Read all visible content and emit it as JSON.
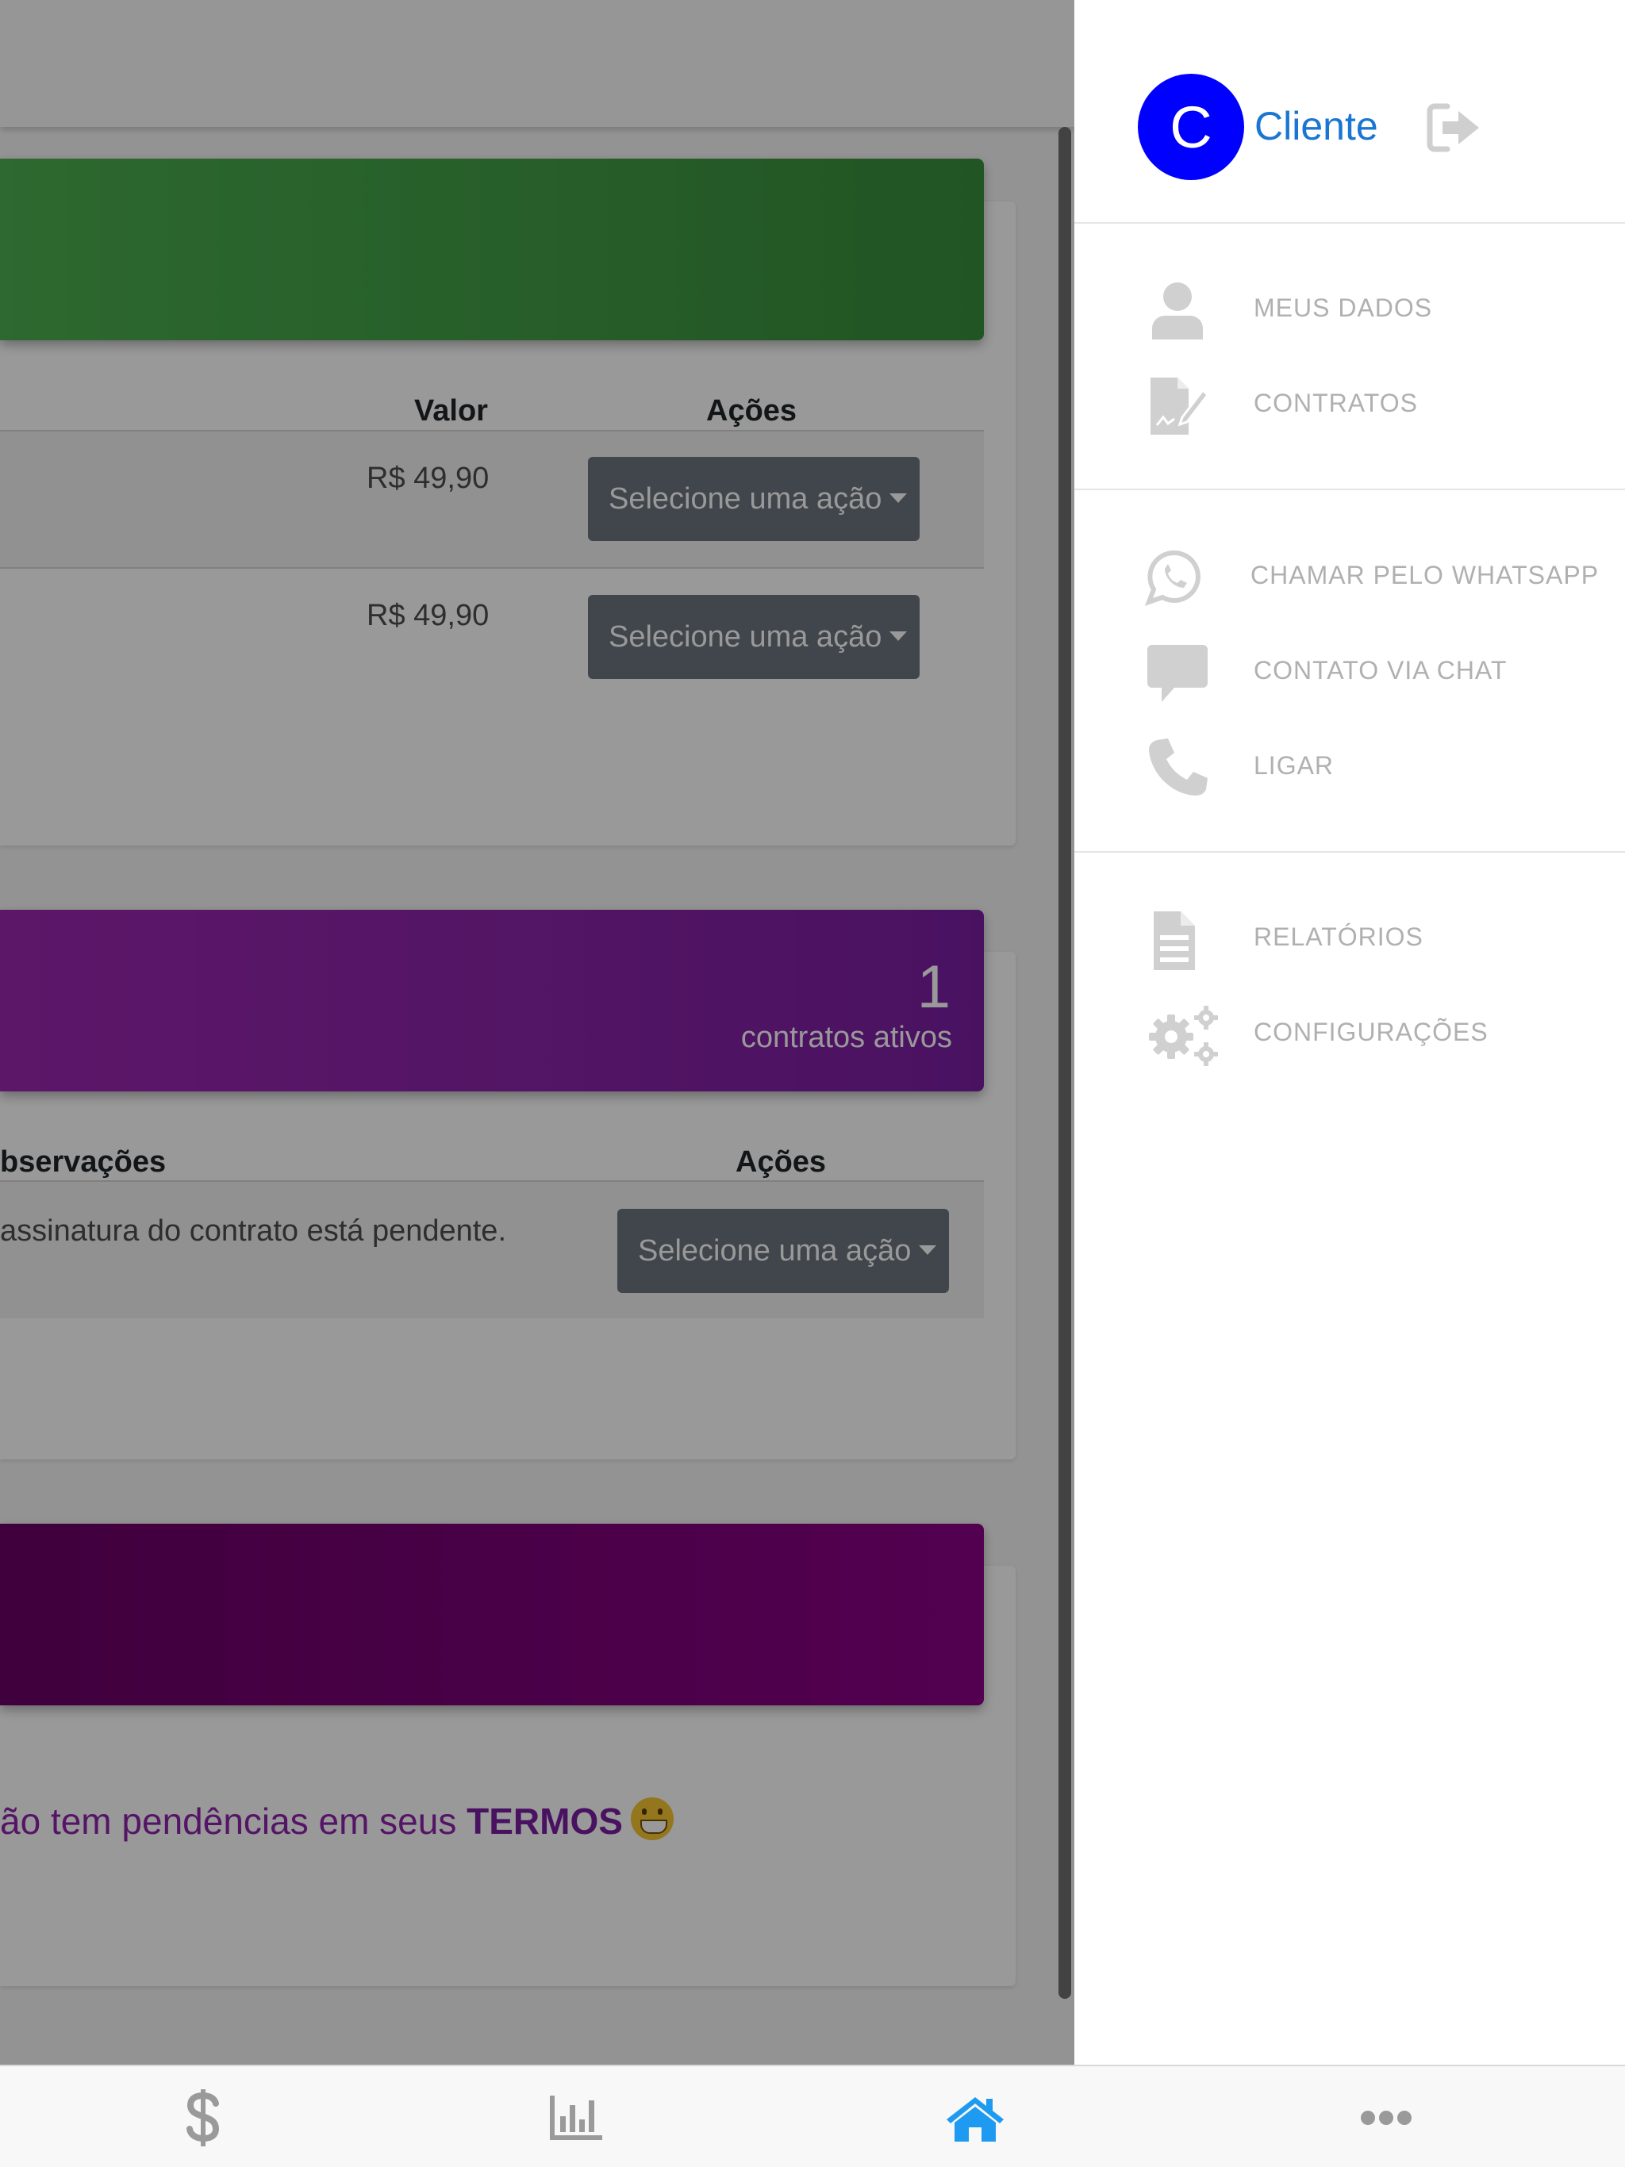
{
  "card1": {
    "col_valor": "Valor",
    "col_acoes": "Ações",
    "rows": [
      {
        "valor": "R$ 49,90",
        "action": "Selecione uma ação"
      },
      {
        "valor": "R$ 49,90",
        "action": "Selecione uma ação"
      }
    ]
  },
  "card2": {
    "count": "1",
    "count_label": "contratos ativos",
    "col_obs": "bservações",
    "col_acoes": "Ações",
    "row": {
      "obs": "assinatura do contrato está pendente.",
      "action": "Selecione uma ação"
    }
  },
  "card3": {
    "message_prefix": "ão tem pendências em seus ",
    "message_bold": "TERMOS"
  },
  "drawer": {
    "avatar_letter": "C",
    "user_name": "Cliente",
    "menu": [
      {
        "label": "MEUS DADOS",
        "icon": "user-icon"
      },
      {
        "label": "CONTRATOS",
        "icon": "contract-sign-icon"
      },
      {
        "label": "CHAMAR PELO WHATSAPP",
        "icon": "whatsapp-icon"
      },
      {
        "label": "CONTATO VIA CHAT",
        "icon": "chat-bubble-icon"
      },
      {
        "label": "LIGAR",
        "icon": "phone-icon"
      },
      {
        "label": "RELATÓRIOS",
        "icon": "report-icon"
      },
      {
        "label": "CONFIGURAÇÕES",
        "icon": "gears-icon"
      }
    ]
  },
  "tabbar": {
    "tabs": [
      {
        "icon": "dollar-icon",
        "active": false
      },
      {
        "icon": "bar-chart-icon",
        "active": false
      },
      {
        "icon": "home-icon",
        "active": true
      },
      {
        "icon": "more-icon",
        "active": false
      }
    ]
  },
  "colors": {
    "active_tab": "#1e9bf0",
    "inactive_tab": "#9a9a9a",
    "avatar": "#0000ff",
    "username": "#1976d2",
    "menu_text": "#b0b0b0"
  }
}
